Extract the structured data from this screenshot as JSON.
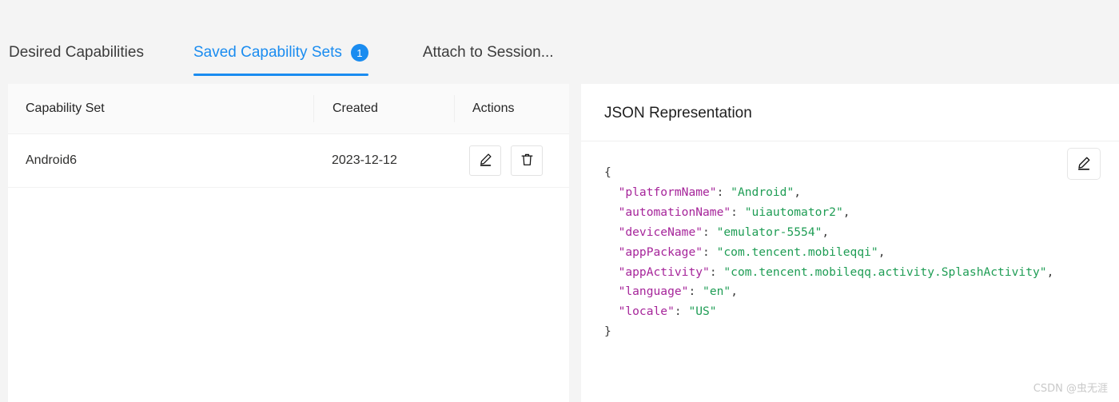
{
  "tabs": [
    {
      "label": "Desired Capabilities",
      "active": false,
      "badge": null
    },
    {
      "label": "Saved Capability Sets",
      "active": true,
      "badge": "1"
    },
    {
      "label": "Attach to Session...",
      "active": false,
      "badge": null
    }
  ],
  "table": {
    "columns": [
      "Capability Set",
      "Created",
      "Actions"
    ],
    "rows": [
      {
        "name": "Android6",
        "created": "2023-12-12",
        "actions": [
          "edit-icon",
          "delete-icon"
        ]
      }
    ]
  },
  "json_panel": {
    "title": "JSON Representation",
    "edit_icon": "edit-icon",
    "code_lines": [
      {
        "indent": 0,
        "raw": "{"
      },
      {
        "indent": 1,
        "key": "platformName",
        "value": "Android",
        "comma": true
      },
      {
        "indent": 1,
        "key": "automationName",
        "value": "uiautomator2",
        "comma": true
      },
      {
        "indent": 1,
        "key": "deviceName",
        "value": "emulator-5554",
        "comma": true
      },
      {
        "indent": 1,
        "key": "appPackage",
        "value": "com.tencent.mobileqqi",
        "comma": true
      },
      {
        "indent": 1,
        "key": "appActivity",
        "value": "com.tencent.mobileqq.activity.SplashActivity",
        "comma": true
      },
      {
        "indent": 1,
        "key": "language",
        "value": "en",
        "comma": true
      },
      {
        "indent": 1,
        "key": "locale",
        "value": "US",
        "comma": false
      },
      {
        "indent": 0,
        "raw": "}"
      }
    ]
  },
  "watermark": "CSDN @虫无涯",
  "colors": {
    "accent": "#1a8cf0",
    "json_key": "#a6259a",
    "json_value": "#1f9d55",
    "page_bg": "#f4f4f4",
    "panel_bg": "#ffffff"
  }
}
